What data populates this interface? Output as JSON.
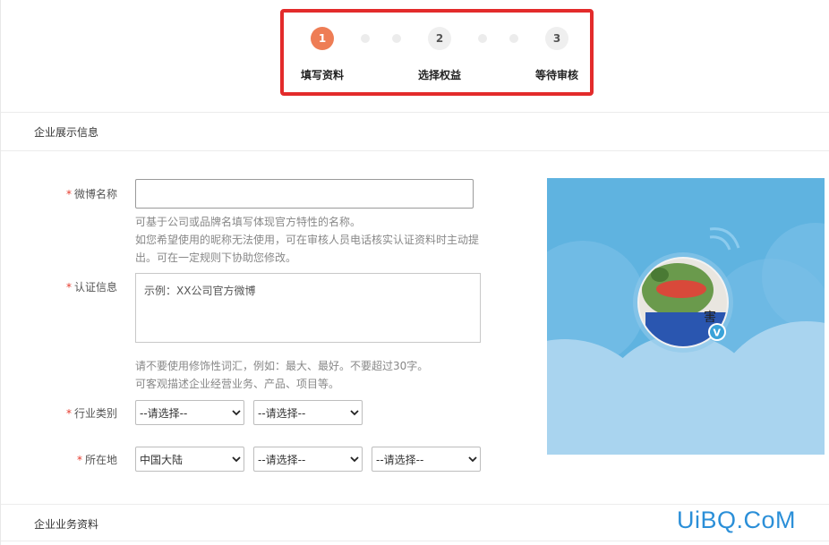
{
  "steps": [
    {
      "number": "1",
      "label": "填写资料",
      "active": true
    },
    {
      "number": "2",
      "label": "选择权益",
      "active": false
    },
    {
      "number": "3",
      "label": "等待审核",
      "active": false
    }
  ],
  "section_display": {
    "title": "企业展示信息"
  },
  "section_business": {
    "title": "企业业务资料"
  },
  "form": {
    "weibo_name": {
      "required_mark": "*",
      "label": "微博名称",
      "value": "",
      "hint_lines": [
        "可基于公司或品牌名填写体现官方特性的名称。",
        "如您希望使用的昵称无法使用，可在审核人员电话核实认证资料时主动提",
        "出。可在一定规则下协助您修改。"
      ]
    },
    "cert_info": {
      "required_mark": "*",
      "label": "认证信息",
      "placeholder": "示例：XX公司官方微博",
      "hint_lines": [
        "请不要使用修饰性词汇，例如：最大、最好。不要超过30字。",
        "可客观描述企业经营业务、产品、项目等。"
      ]
    },
    "industry": {
      "required_mark": "*",
      "label": "行业类别",
      "selects": [
        "--请选择--",
        "--请选择--"
      ]
    },
    "location": {
      "required_mark": "*",
      "label": "所在地",
      "selects": [
        "中国大陆",
        "--请选择--",
        "--请选择--"
      ]
    }
  },
  "preview": {
    "avatar_text": "害",
    "verified_badge": "V",
    "sky_color": "#5fb3e0",
    "cloud_color": "#a9d4ef"
  },
  "watermark": "UiBQ.CoM",
  "colors": {
    "accent": "#ee7d55",
    "highlight_border": "#e32b2b",
    "required": "#e63b2e"
  }
}
